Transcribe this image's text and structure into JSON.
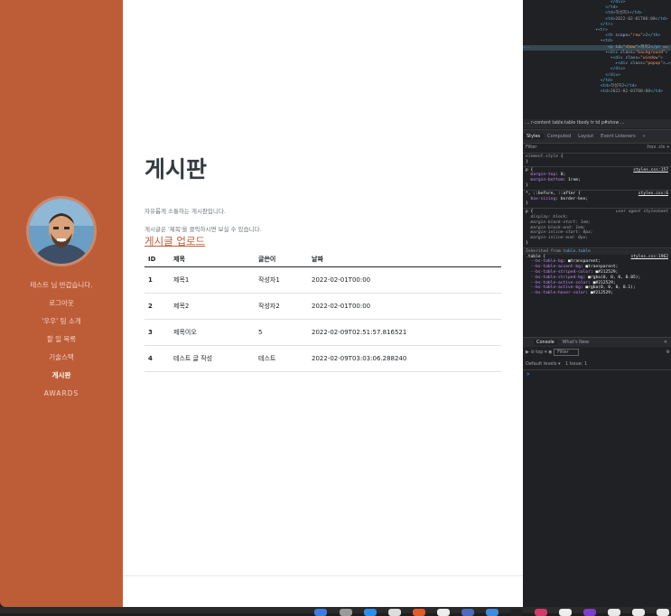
{
  "sidebar": {
    "nav": [
      "테스트 님 반갑습니다.",
      "로그아웃",
      "'우우' 팀 소개",
      "할 일 목록",
      "기술스택",
      "게시판",
      "AWARDS"
    ]
  },
  "main": {
    "title": "게시판",
    "desc1": "자유롭게 소통하는 게시판입니다.",
    "desc2": "게시글은 '제목'을 클릭하시면 보실 수 있습니다.",
    "upload_link": "게시글 업로드",
    "table": {
      "headers": [
        "ID",
        "제목",
        "글쓴이",
        "날짜"
      ],
      "rows": [
        [
          "1",
          "제목1",
          "작성자1",
          "2022-02-01T00:00"
        ],
        [
          "2",
          "제목2",
          "작성자2",
          "2022-02-01T00:00"
        ],
        [
          "3",
          "제목이오",
          "5",
          "2022-02-09T02:51:57.816521"
        ],
        [
          "4",
          "테스트 글 작성",
          "테스트",
          "2022-02-09T03:03:06.288240"
        ]
      ]
    }
  },
  "devtools": {
    "breadcrumb": "... r-content   table.table   tbody   tr   td   p#show ...",
    "tabs": [
      "Styles",
      "Computed",
      "Layout",
      "Event Listeners",
      "»"
    ],
    "filter_placeholder": "Filter",
    "filter_right": ":hov  .cls  +",
    "console_tabs": [
      "Console",
      "What's New"
    ],
    "console_context": "top",
    "console_filter": "Filter",
    "console_levels": "Default levels ▾",
    "console_issues": "1 Issue: 1",
    "prompt": ">"
  }
}
